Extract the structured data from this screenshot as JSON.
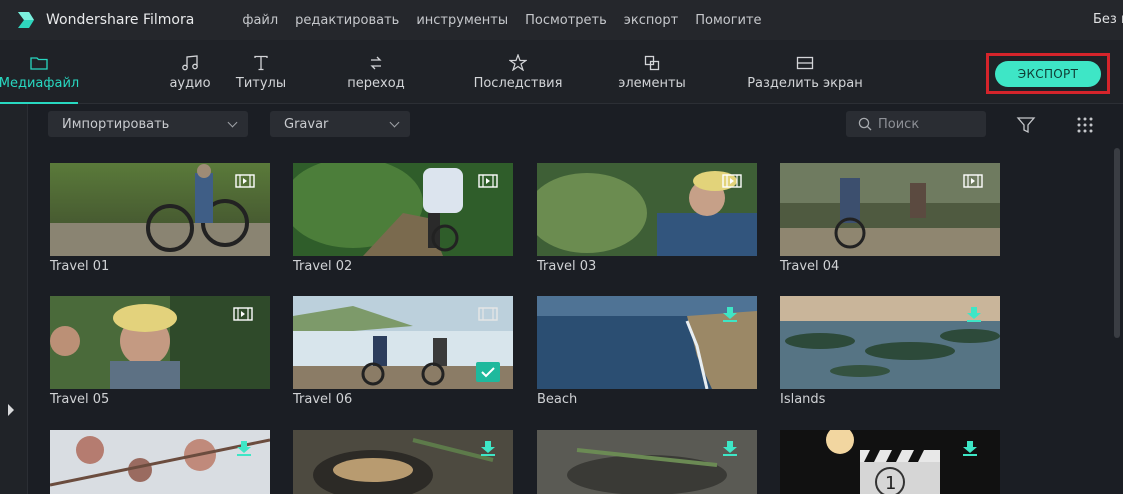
{
  "app": {
    "title": "Wondershare Filmora",
    "project_name": "Без названия",
    "menu": [
      "файл",
      "редактировать",
      "инструменты",
      "Посмотреть",
      "экспорт",
      "Помогите"
    ]
  },
  "toolbar": {
    "tabs": [
      {
        "label": "Медиафайл",
        "icon": "folder-icon",
        "active": true
      },
      {
        "label": "аудио",
        "icon": "music-note-icon",
        "active": false
      },
      {
        "label": "Титулы",
        "icon": "text-t-icon",
        "active": false
      },
      {
        "label": "переход",
        "icon": "transition-icon",
        "active": false
      },
      {
        "label": "Последствия",
        "icon": "effects-star-icon",
        "active": false
      },
      {
        "label": "элементы",
        "icon": "elements-icon",
        "active": false
      },
      {
        "label": "Разделить экран",
        "icon": "split-screen-icon",
        "active": false
      }
    ],
    "export_label": "ЭКСПОРТ"
  },
  "filterbar": {
    "import_label": "Импортировать",
    "gravar_label": "Gravar",
    "search_placeholder": "Поиск"
  },
  "media": [
    {
      "label": "Travel 01",
      "badge": "video-icon"
    },
    {
      "label": "Travel 02",
      "badge": "video-icon"
    },
    {
      "label": "Travel 03",
      "badge": "video-icon"
    },
    {
      "label": "Travel 04",
      "badge": "video-icon"
    },
    {
      "label": "Travel 05",
      "badge": "video-icon"
    },
    {
      "label": "Travel 06",
      "badge": "added-check-icon"
    },
    {
      "label": "Beach",
      "badge": "download-icon"
    },
    {
      "label": "Islands",
      "badge": "download-icon"
    },
    {
      "label": "",
      "badge": "download-icon"
    },
    {
      "label": "",
      "badge": "download-icon"
    },
    {
      "label": "",
      "badge": "download-icon"
    },
    {
      "label": "",
      "badge": "download-icon"
    }
  ],
  "colors": {
    "accent": "#28d8c1",
    "export_button": "#3ee6c6",
    "highlight_frame": "#d5242b",
    "background": "#1b1e24"
  }
}
